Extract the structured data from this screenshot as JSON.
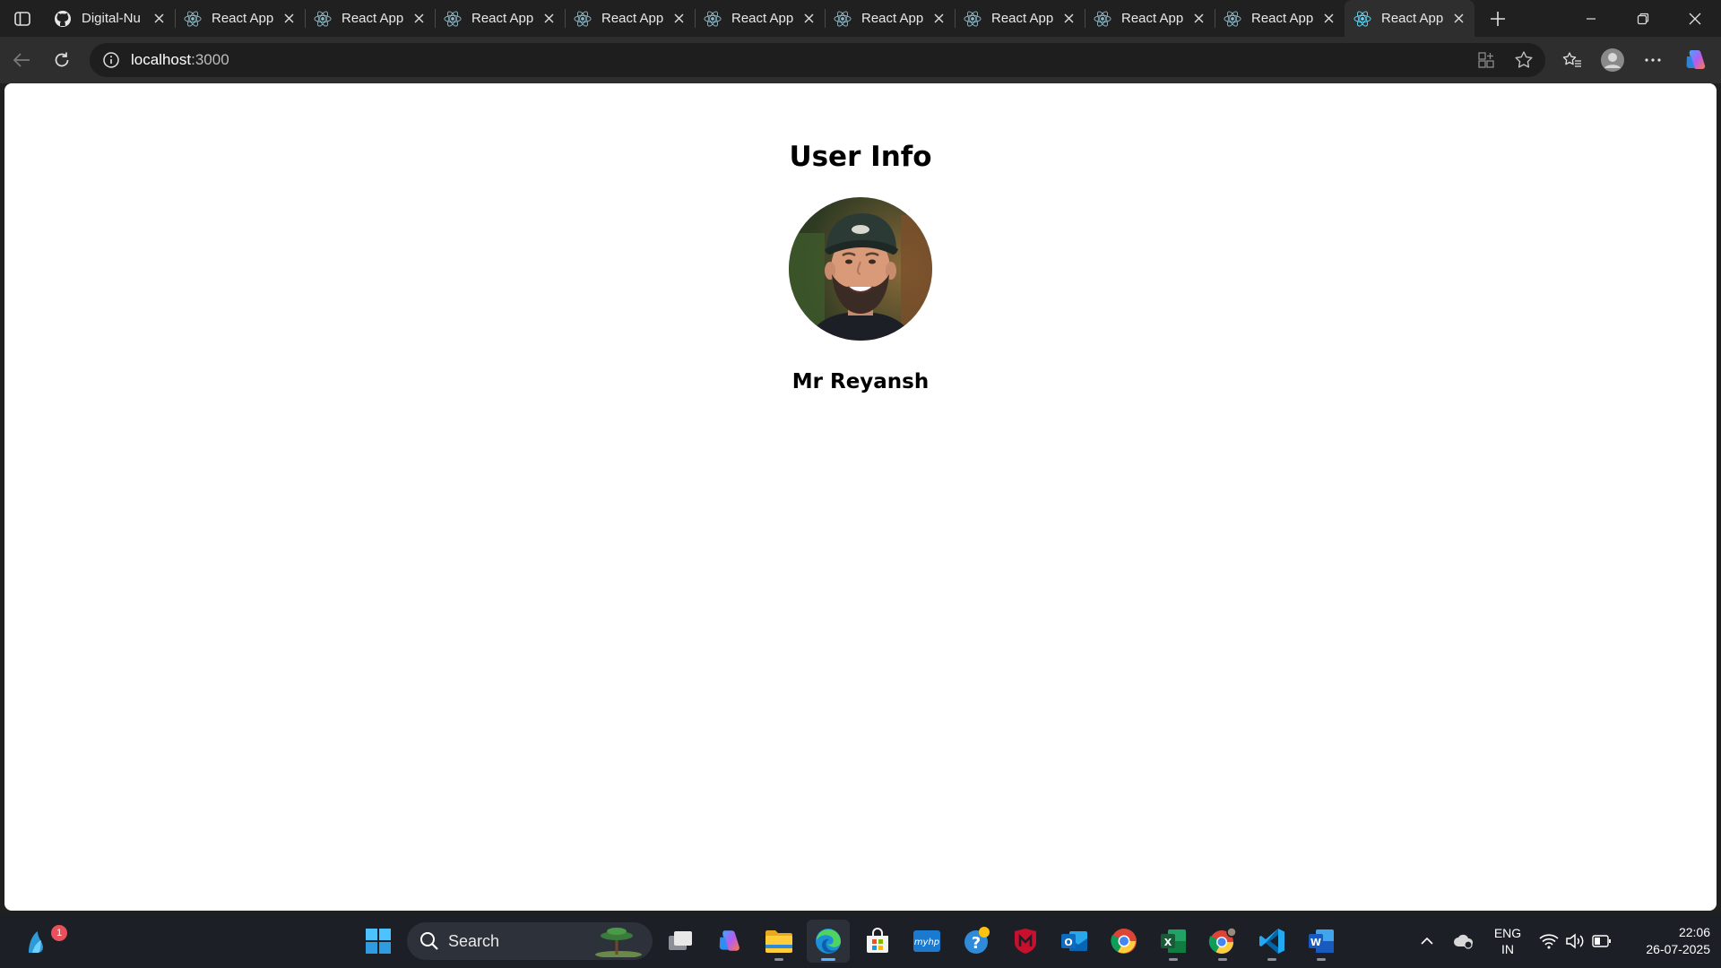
{
  "browser": {
    "tabs": [
      {
        "title": "Digital-Nu",
        "favicon": "github-icon",
        "active": false
      },
      {
        "title": "React App",
        "favicon": "react-icon",
        "active": false
      },
      {
        "title": "React App",
        "favicon": "react-icon",
        "active": false
      },
      {
        "title": "React App",
        "favicon": "react-icon",
        "active": false
      },
      {
        "title": "React App",
        "favicon": "react-icon",
        "active": false
      },
      {
        "title": "React App",
        "favicon": "react-icon",
        "active": false
      },
      {
        "title": "React App",
        "favicon": "react-icon",
        "active": false
      },
      {
        "title": "React App",
        "favicon": "react-icon",
        "active": false
      },
      {
        "title": "React App",
        "favicon": "react-icon",
        "active": false
      },
      {
        "title": "React App",
        "favicon": "react-icon",
        "active": false
      },
      {
        "title": "React App",
        "favicon": "react-icon",
        "active": true
      }
    ],
    "address": {
      "host": "localhost",
      "port": ":3000"
    }
  },
  "page": {
    "title": "User Info",
    "user_name": "Mr Reyansh",
    "avatar": "bearded-man-in-cap-photo"
  },
  "taskbar": {
    "search_label": "Search",
    "widgets_badge": "1",
    "language": {
      "line1": "ENG",
      "line2": "IN"
    },
    "clock": {
      "time": "22:06",
      "date": "26-07-2025"
    },
    "apps": [
      "widgets-icon",
      "windows-start-icon",
      "task-view-icon",
      "copilot-icon",
      "file-explorer-icon",
      "edge-icon",
      "ms-store-icon",
      "myhp-icon",
      "get-help-icon",
      "mcafee-icon",
      "outlook-icon",
      "chrome-icon",
      "excel-icon",
      "chrome-profile-icon",
      "vscode-icon",
      "word-icon"
    ]
  },
  "colors": {
    "titlebar": "#202020",
    "toolbar": "#2e2e2e",
    "page_background": "#ffffff",
    "taskbar": "#1c1f26",
    "accent": "#5fb2ff"
  }
}
